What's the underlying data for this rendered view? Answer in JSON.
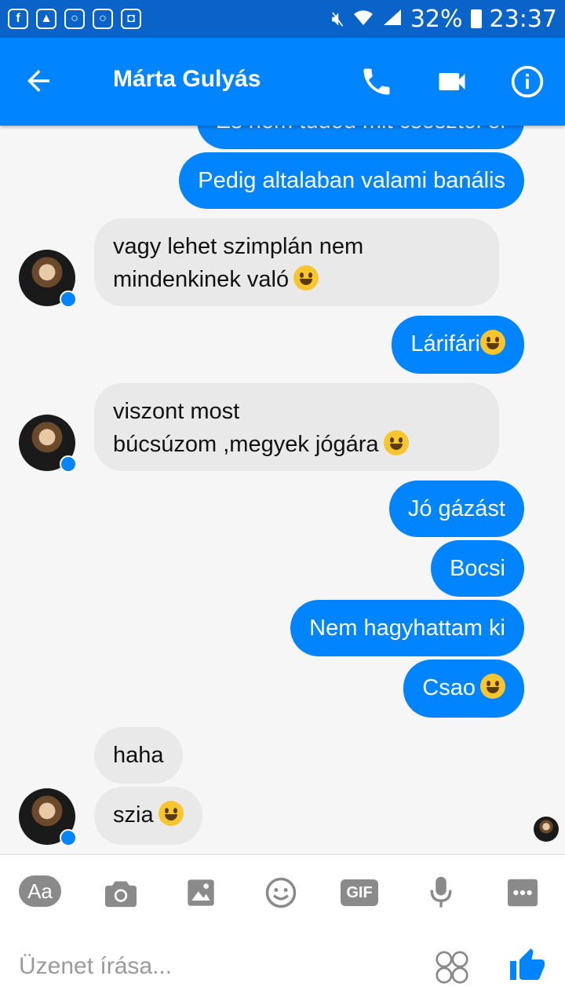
{
  "status_bar": {
    "battery": "32%",
    "time": "23:37"
  },
  "header": {
    "contact_name": "Márta Gulyás"
  },
  "messages": {
    "m0": "És nem tudod mit csesztél el",
    "m1": "Pedig altalaban valami banális",
    "m2a": "vagy lehet szimplán nem",
    "m2b": "mindenkinek való",
    "m3": "Lárifári",
    "m4a": "viszont most",
    "m4b": "búcsúzom ,megyek jógára",
    "m5": "Jó gázást",
    "m6": "Bocsi",
    "m7": "Nem hagyhattam ki",
    "m8": "Csao",
    "m9": "haha",
    "m10": "szia"
  },
  "toolbar": {
    "aa_label": "Aa",
    "gif_label": "GIF"
  },
  "composer": {
    "placeholder": "Üzenet írása..."
  }
}
